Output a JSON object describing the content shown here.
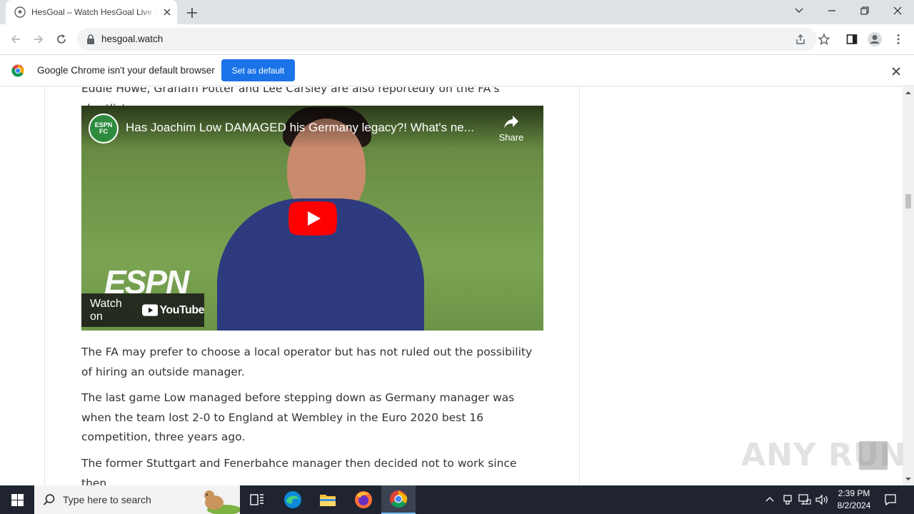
{
  "browser": {
    "tab_title": "HesGoal – Watch HesGoal Live Streams",
    "url": "hesgoal.watch",
    "new_tab": "+"
  },
  "infobar": {
    "message": "Google Chrome isn't your default browser",
    "button": "Set as default"
  },
  "article": {
    "para_top": "Eddie Howe, Graham Potter and Lee Carsley are also reportedly on the FA's shortlist.",
    "video": {
      "channel": "ESPN FC",
      "title": "Has Joachim Low DAMAGED his Germany legacy?! What's ne...",
      "share": "Share",
      "watch_on": "Watch on",
      "youtube": "YouTube",
      "watermark": "ESPN"
    },
    "para1": "The FA may prefer to choose a local operator but has not ruled out the possibility of hiring an outside manager.",
    "para2": "The last game Low managed before stepping down as Germany manager was when the team lost 2-0 to England at Wembley in the Euro 2020 best 16 competition, three years ago.",
    "para3": "The former Stuttgart and Fenerbahce manager then decided not to work since then."
  },
  "watermark": "ANY RUN",
  "taskbar": {
    "search_placeholder": "Type here to search",
    "time": "2:39 PM",
    "date": "8/2/2024"
  },
  "colors": {
    "accent": "#1a73e8",
    "taskbar": "#1f2430",
    "youtube_red": "#ff0000"
  }
}
